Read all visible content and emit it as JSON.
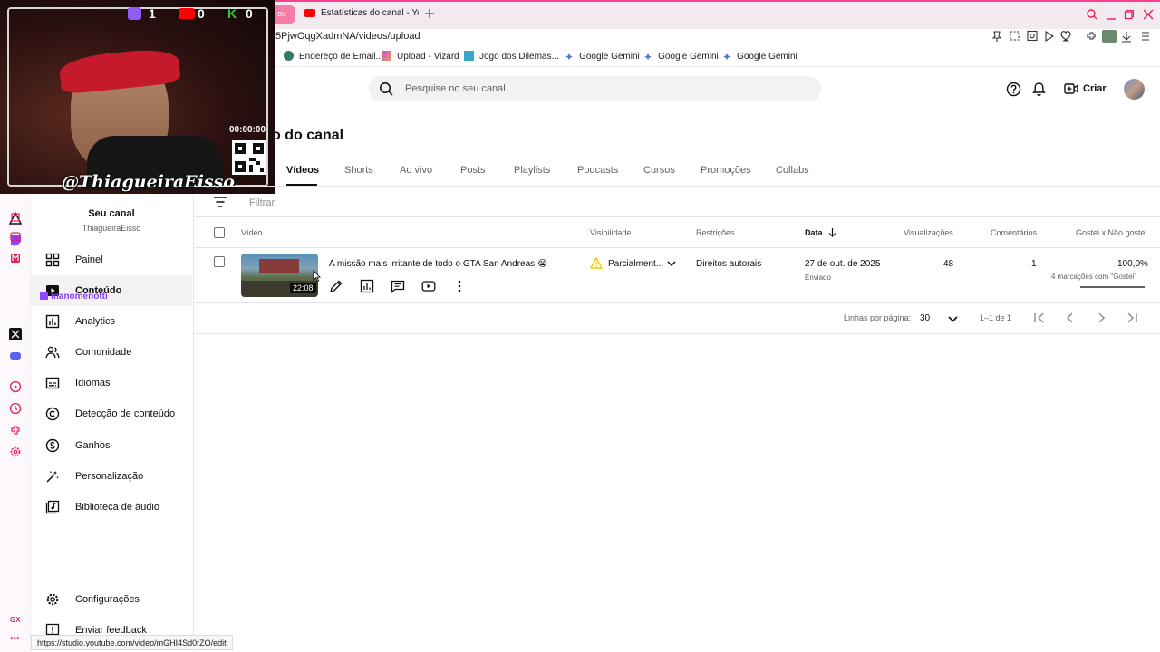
{
  "browser": {
    "tab_prev_label": "ou",
    "tab_active_title": "Estatísticas do canal - Yo",
    "url": "5PjwOqgXadmNA/videos/upload",
    "bookmarks": [
      "Endereço de Email...",
      "Upload - Vizard",
      "Jogo dos Dilemas...",
      "Google Gemini",
      "Google Gemini",
      "Google Gemini"
    ]
  },
  "overlay": {
    "counters": [
      "1",
      "0",
      "0"
    ],
    "timer": "00:00:00",
    "handle": "@ThiagueiraEisso",
    "chat_user": "manomenotti"
  },
  "header": {
    "search_placeholder": "Pesquise no seu canal",
    "create_label": "Criar"
  },
  "channel": {
    "name": "Seu canal",
    "handle": "ThiagueiraEisso"
  },
  "nav": {
    "items": [
      {
        "label": "Painel",
        "icon": "dashboard-icon"
      },
      {
        "label": "Conteúdo",
        "icon": "content-icon"
      },
      {
        "label": "Analytics",
        "icon": "analytics-icon"
      },
      {
        "label": "Comunidade",
        "icon": "community-icon"
      },
      {
        "label": "Idiomas",
        "icon": "subtitles-icon"
      },
      {
        "label": "Detecção de conteúdo",
        "icon": "copyright-icon"
      },
      {
        "label": "Ganhos",
        "icon": "earnings-icon"
      },
      {
        "label": "Personalização",
        "icon": "customization-icon"
      },
      {
        "label": "Biblioteca de áudio",
        "icon": "audio-library-icon"
      }
    ],
    "settings_label": "Configurações",
    "feedback_label": "Enviar feedback"
  },
  "page": {
    "title": "o do canal",
    "tabs": [
      "Vídeos",
      "Shorts",
      "Ao vivo",
      "Posts",
      "Playlists",
      "Podcasts",
      "Cursos",
      "Promoções",
      "Collabs"
    ],
    "filter_label": "Filtrar"
  },
  "table": {
    "headers": {
      "video": "Vídeo",
      "visibility": "Visibilidade",
      "restrictions": "Restrições",
      "date": "Data",
      "views": "Visualizações",
      "comments": "Comentários",
      "likes": "Gostei x Não gostei"
    },
    "rows": [
      {
        "title": "A missão mais irritante de todo o GTA San Andreas 😭",
        "duration": "22:08",
        "visibility": "Parcialment...",
        "restrictions": "Direitos autorais",
        "date": "27 de out. de 2025",
        "date_status": "Enviado",
        "views": "48",
        "comments": "1",
        "like_ratio": "100,0%",
        "like_count_text": "4 marcações com \"Gostei\""
      }
    ]
  },
  "pagination": {
    "rows_per_page_label": "Linhas por página:",
    "rows_per_page_value": "30",
    "range_text": "1–1 de 1"
  },
  "status_link": "https://studio.youtube.com/video/mGHI4Sd0rZQ/edit",
  "colors": {
    "youtube_red": "#ff0000",
    "opera_accent": "#ff3e8f",
    "warning": "#f9c800"
  }
}
